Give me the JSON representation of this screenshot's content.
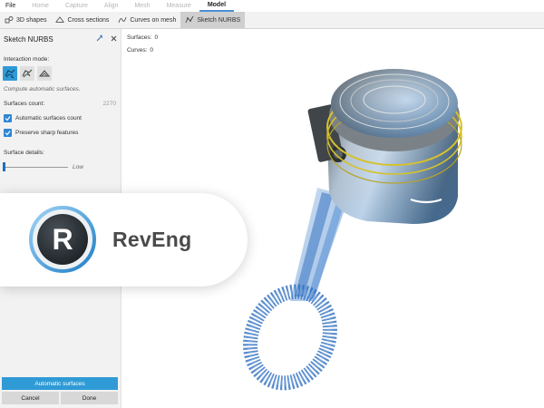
{
  "menu": {
    "items": [
      {
        "label": "File",
        "state": "normal"
      },
      {
        "label": "Home",
        "state": "disabled"
      },
      {
        "label": "Capture",
        "state": "disabled"
      },
      {
        "label": "Align",
        "state": "disabled"
      },
      {
        "label": "Mesh",
        "state": "disabled"
      },
      {
        "label": "Measure",
        "state": "disabled"
      },
      {
        "label": "Model",
        "state": "active"
      }
    ]
  },
  "toolbar": {
    "items": [
      {
        "label": "3D shapes",
        "icon": "shapes-icon"
      },
      {
        "label": "Cross sections",
        "icon": "cross-section-icon"
      },
      {
        "label": "Curves on mesh",
        "icon": "curve-icon"
      },
      {
        "label": "Sketch NURBS",
        "icon": "nurbs-icon",
        "active": true
      }
    ]
  },
  "panel": {
    "title": "Sketch NURBS",
    "interaction_label": "Interaction mode:",
    "hint": "Compute automatic surfaces.",
    "surfaces_count_label": "Surfaces count:",
    "surfaces_count_value": "2270",
    "checkboxes": [
      {
        "label": "Automatic surfaces count",
        "checked": true
      },
      {
        "label": "Preserve sharp features",
        "checked": true
      }
    ],
    "surface_details_label": "Surface details:",
    "surface_details_value": "Low",
    "auto_button": "Automatic surfaces",
    "cancel_button": "Cancel",
    "done_button": "Done"
  },
  "viewport": {
    "surfaces_label": "Surfaces:",
    "surfaces_value": "0",
    "curves_label": "Curves:",
    "curves_value": "0"
  },
  "banner": {
    "brand": "RevEng",
    "logo_letter": "R"
  },
  "colors": {
    "accent": "#2f9bd6",
    "checkbox": "#2f86d6",
    "point_cloud": "#1f5fb0",
    "brand_text": "#4a4a4a"
  }
}
